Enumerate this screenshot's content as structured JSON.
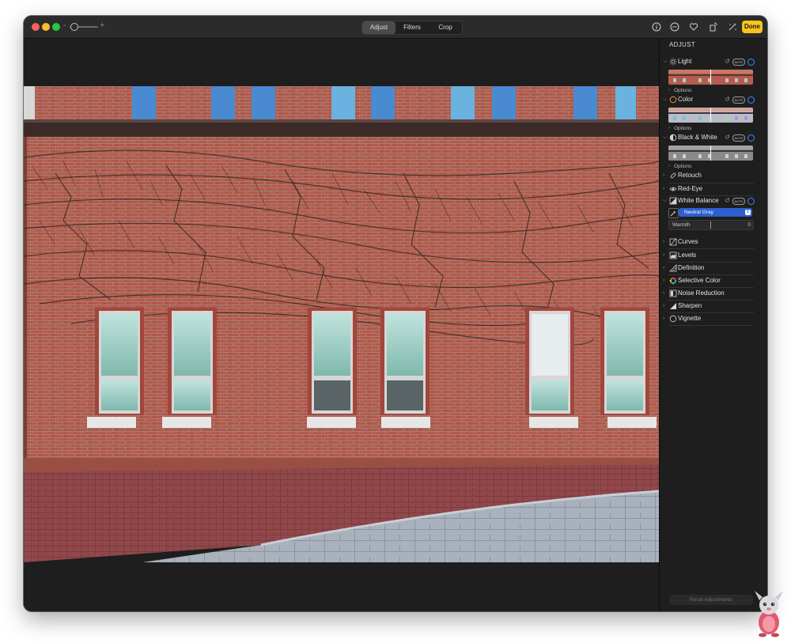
{
  "toolbar": {
    "zoom_minus": "-",
    "zoom_plus": "+",
    "zoom_level": 0.1,
    "tabs": [
      {
        "label": "Adjust",
        "selected": true
      },
      {
        "label": "Filters",
        "selected": false
      },
      {
        "label": "Crop",
        "selected": false
      }
    ],
    "icons": [
      "info-icon",
      "more-icon",
      "favorite-icon",
      "rotate-icon",
      "auto-enhance-icon"
    ],
    "done_label": "Done"
  },
  "colors": {
    "accent": "#3b8bff",
    "done": "#f7c51c",
    "select": "#2e5fcf"
  },
  "sidebar": {
    "title": "ADJUST",
    "sections": {
      "light": {
        "label": "Light",
        "auto": "AUTO",
        "options": "Options",
        "expanded": true
      },
      "color": {
        "label": "Color",
        "auto": "AUTO",
        "options": "Options",
        "expanded": true
      },
      "bw": {
        "label": "Black & White",
        "auto": "AUTO",
        "options": "Options",
        "expanded": true
      },
      "retouch": {
        "label": "Retouch"
      },
      "redeye": {
        "label": "Red-Eye"
      },
      "wb": {
        "label": "White Balance",
        "auto": "AUTO",
        "mode": "Neutral Gray",
        "warmth_label": "Warmth",
        "warmth_value": "0",
        "expanded": true
      },
      "curves": {
        "label": "Curves"
      },
      "levels": {
        "label": "Levels"
      },
      "definition": {
        "label": "Definition"
      },
      "selective_color": {
        "label": "Selective Color"
      },
      "noise_reduction": {
        "label": "Noise Reduction"
      },
      "sharpen": {
        "label": "Sharpen"
      },
      "vignette": {
        "label": "Vignette"
      }
    },
    "reset_label": "Reset Adjustments"
  }
}
